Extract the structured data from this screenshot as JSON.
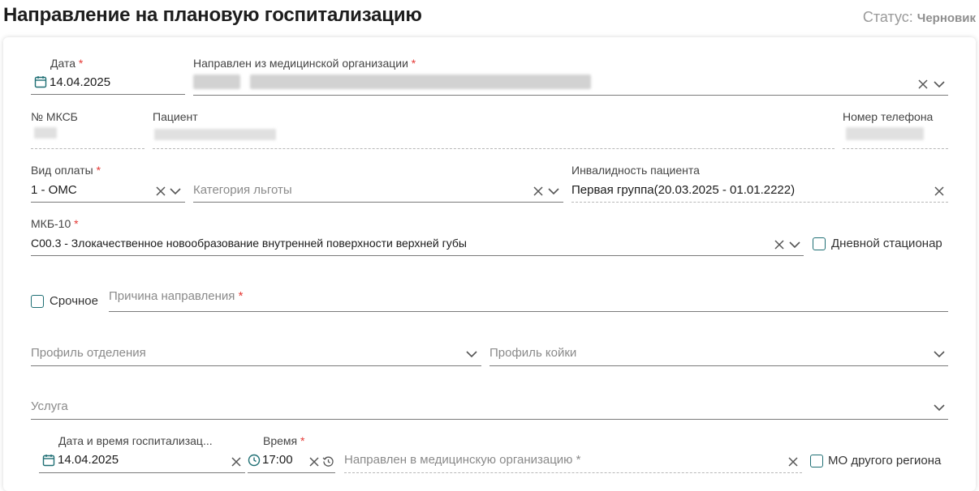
{
  "header": {
    "title": "Направление на плановую госпитализацию",
    "status_label": "Статус:",
    "status_value": "Черновик"
  },
  "form": {
    "date": {
      "label": "Дата",
      "required_mark": "*",
      "value": "14.04.2025"
    },
    "referred_from": {
      "label": "Направлен из медицинской организации",
      "required_mark": "*",
      "value_hidden": true
    },
    "mksb": {
      "label": "№ МКСБ"
    },
    "patient": {
      "label": "Пациент"
    },
    "phone": {
      "label": "Номер телефона"
    },
    "payment_type": {
      "label": "Вид оплаты",
      "required_mark": "*",
      "value": "1 - ОМС"
    },
    "benefit_category": {
      "placeholder": "Категория льготы"
    },
    "disability": {
      "label": "Инвалидность пациента",
      "value": "Первая группа(20.03.2025 - 01.01.2222)"
    },
    "mkb10": {
      "label": "МКБ-10",
      "required_mark": "*",
      "value": "C00.3 - Злокачественное новообразование внутренней поверхности верхней губы"
    },
    "day_hospital": {
      "label": "Дневной стационар",
      "checked": false
    },
    "urgent": {
      "label": "Срочное",
      "checked": false
    },
    "reason": {
      "placeholder": "Причина направления",
      "required_mark": "*"
    },
    "department_profile": {
      "placeholder": "Профиль отделения"
    },
    "bed_profile": {
      "placeholder": "Профиль койки"
    },
    "service": {
      "placeholder": "Услуга"
    },
    "hosp_date": {
      "label": "Дата и время госпитализац...",
      "value": "14.04.2025"
    },
    "time": {
      "label": "Время",
      "required_mark": "*",
      "value": "17:00"
    },
    "referred_to": {
      "placeholder": "Направлен в медицинскую организацию *"
    },
    "other_region": {
      "label": "МО другого региона",
      "checked": false
    }
  },
  "colors": {
    "required": "#e53935",
    "checkbox_border": "#1f6f74",
    "icon": "#555555"
  }
}
